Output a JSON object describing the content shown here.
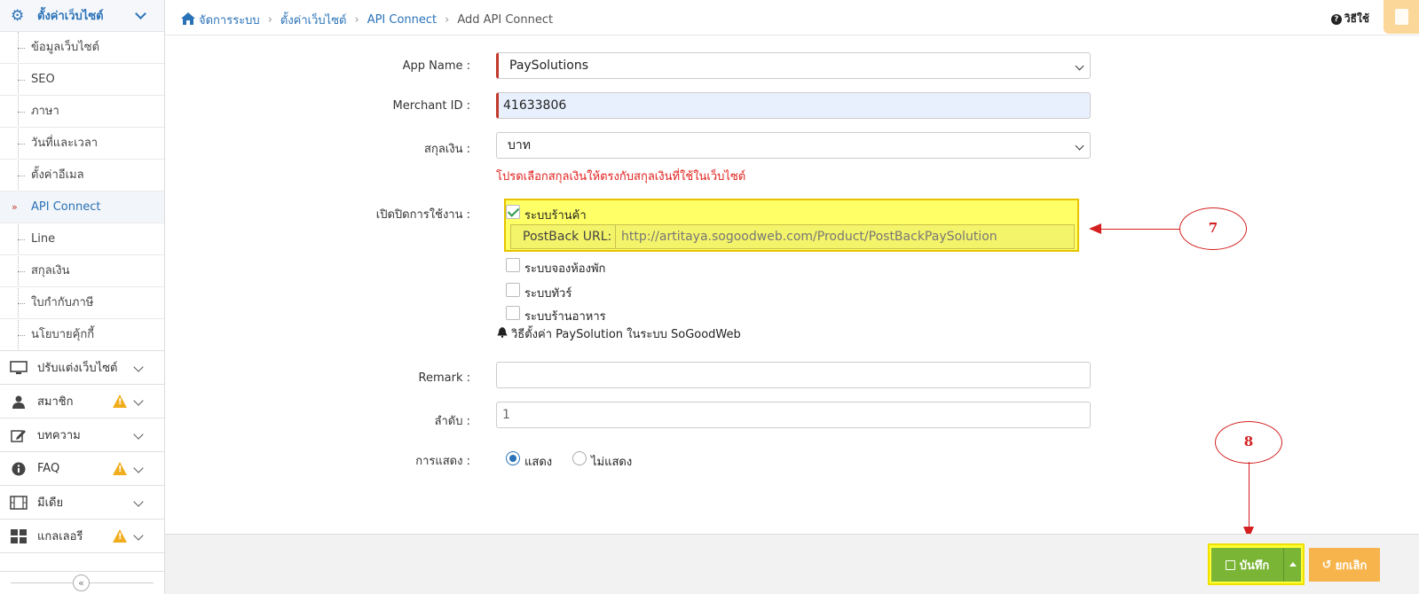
{
  "sidebar": {
    "header": {
      "label": "ตั้งค่าเว็บไซต์",
      "icon": "gear-icon"
    },
    "sub_items": [
      {
        "label": "ข้อมูลเว็บไซต์",
        "active": false
      },
      {
        "label": "SEO",
        "active": false
      },
      {
        "label": "ภาษา",
        "active": false
      },
      {
        "label": "วันที่และเวลา",
        "active": false
      },
      {
        "label": "ตั้งค่าอีเมล",
        "active": false
      },
      {
        "label": "API Connect",
        "active": true
      },
      {
        "label": "Line",
        "active": false
      },
      {
        "label": "สกุลเงิน",
        "active": false
      },
      {
        "label": "ใบกำกับภาษี",
        "active": false
      },
      {
        "label": "นโยบายคุ้กกี้",
        "active": false
      }
    ],
    "groups": [
      {
        "label": "ปรับแต่งเว็บไซต์",
        "icon": "monitor-icon",
        "warning": false
      },
      {
        "label": "สมาชิก",
        "icon": "user-icon",
        "warning": true
      },
      {
        "label": "บทความ",
        "icon": "edit-icon",
        "warning": false
      },
      {
        "label": "FAQ",
        "icon": "info-icon",
        "warning": true
      },
      {
        "label": "มีเดีย",
        "icon": "film-icon",
        "warning": false
      },
      {
        "label": "แกลเลอรี",
        "icon": "grid-icon",
        "warning": true
      }
    ],
    "active_mark": "»",
    "collapse_glyph": "«"
  },
  "breadcrumb": [
    "จัดการระบบ",
    "ตั้งค่าเว็บไซต์",
    "API Connect",
    "Add API Connect"
  ],
  "help": {
    "q": "?",
    "label": "วิธีใช้"
  },
  "form": {
    "app_name": {
      "label": "App Name :",
      "value": "PaySolutions"
    },
    "merchant_id": {
      "label": "Merchant ID :",
      "value": "41633806"
    },
    "currency": {
      "label": "สกุลเงิน :",
      "value": "บาท",
      "hint": "โปรดเลือกสกุลเงินให้ตรงกับสกุลเงินที่ใช้ในเว็บไซต์"
    },
    "enable": {
      "label": "เปิดปิดการใช้งาน :",
      "options": [
        {
          "label": "ระบบร้านค้า",
          "checked": true
        },
        {
          "label": "ระบบจองห้องพัก",
          "checked": false
        },
        {
          "label": "ระบบทัวร์",
          "checked": false
        },
        {
          "label": "ระบบร้านอาหาร",
          "checked": false
        }
      ],
      "postback_label": "PostBack URL:",
      "postback_value": "http://artitaya.sogoodweb.com/Product/PostBackPaySolution",
      "howto": "วิธีตั้งค่า PaySolution ในระบบ SoGoodWeb"
    },
    "remark": {
      "label": "Remark :",
      "value": ""
    },
    "order": {
      "label": "ลำดับ :",
      "value": "1"
    },
    "display": {
      "label": "การแสดง :",
      "options": [
        {
          "label": "แสดง",
          "selected": true
        },
        {
          "label": "ไม่แสดง",
          "selected": false
        }
      ]
    }
  },
  "buttons": {
    "save": "บันทึก",
    "cancel": "ยกเลิก"
  },
  "annotations": {
    "step7": "7",
    "step8": "8"
  },
  "colors": {
    "accent": "#2a72b8",
    "save": "#7ab536",
    "cancel": "#f8b44c",
    "annotation": "#d42020",
    "highlight": "#ffff66"
  }
}
